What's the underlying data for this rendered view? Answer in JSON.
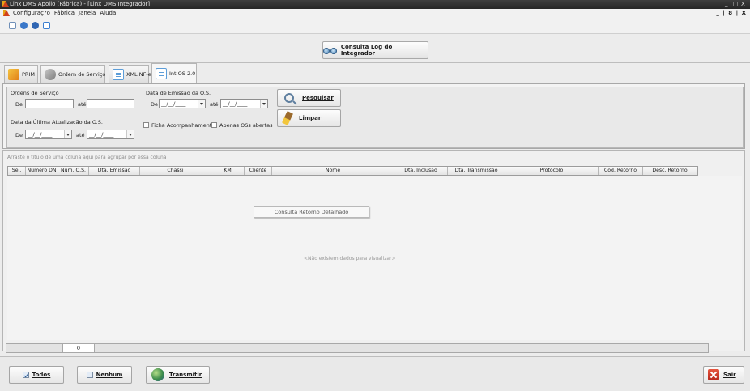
{
  "window": {
    "title": "Linx DMS Apollo (Fábrica) - [Linx DMS Integrador]",
    "controls": [
      "_",
      "□",
      "X"
    ],
    "mdi_controls": "_ | 8 | X"
  },
  "menu": {
    "items": [
      "Configuraç?o",
      "Fábrica",
      "Janela",
      "Ajuda"
    ]
  },
  "toolbar": {
    "icons": [
      "document-icon",
      "gear-icon",
      "info-icon",
      "layout-icon"
    ]
  },
  "header": {
    "log_button": "Consulta Log do Integrador",
    "log_button_hotkey": "C"
  },
  "tabs": [
    {
      "label": "PRIM",
      "icon": "prim-icon"
    },
    {
      "label": "Ordem de Serviço",
      "icon": "tools-icon"
    },
    {
      "label": "XML NF-e",
      "icon": "document-icon"
    },
    {
      "label": "Int OS 2.0",
      "icon": "document-icon",
      "active": true
    }
  ],
  "filters": {
    "ordens_label": "Ordens de Serviço",
    "de_label": "De",
    "ate_label": "até",
    "ordens_de_value": "",
    "ordens_ate_value": "",
    "emissao_label": "Data de Emissão da O.S.",
    "emissao_de_value": "__/__/____",
    "emissao_ate_value": "__/__/____",
    "atualizacao_label": "Data da Última Atualização da O.S.",
    "atualizacao_de_value": "__/__/____",
    "atualizacao_ate_value": "__/__/____",
    "ficha_label": "Ficha Acompanhamento",
    "ficha_checked": false,
    "abertas_label": "Apenas OSs abertas",
    "abertas_checked": false,
    "search_button": "Pesquisar",
    "clear_button": "Limpar"
  },
  "grid": {
    "group_hint": "Arraste o título de uma coluna aqui para agrupar por essa coluna",
    "columns": [
      "Sel.",
      "Número DN",
      "Núm. O.S.",
      "Dta. Emissão",
      "Chassi",
      "KM",
      "Cliente",
      "Nome",
      "Dta. Inclusão",
      "Dta. Transmissão",
      "Protocolo",
      "Cód. Retorno",
      "Desc. Retorno"
    ],
    "empty_text": "<Não existem dados para visualizar>",
    "context_menu_item": "Consulta Retorno Detalhado",
    "footer_count": "0"
  },
  "actions": {
    "todos": "Todos",
    "nenhum": "Nenhum",
    "transmitir": "Transmitir",
    "sair": "Sair"
  },
  "colors": {
    "titlebar": "#2f2f2f",
    "window_bg": "#ececec",
    "close_red": "#c9301f"
  }
}
